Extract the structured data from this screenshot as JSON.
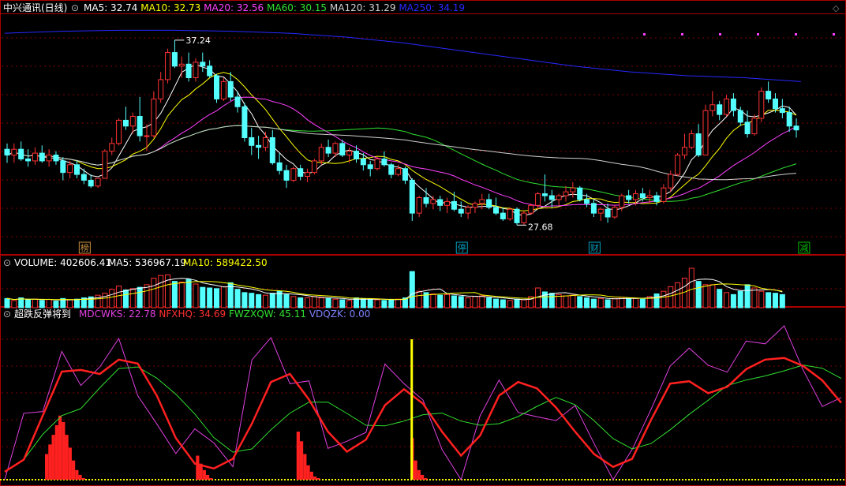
{
  "price_panel": {
    "title": "中兴通讯(日线)",
    "mas": [
      {
        "label": "MA5: 32.74",
        "color": "#ffffff"
      },
      {
        "label": "MA10: 32.73",
        "color": "#ffff00"
      },
      {
        "label": "MA20: 32.56",
        "color": "#ff40ff"
      },
      {
        "label": "MA60: 30.15",
        "color": "#30e030"
      },
      {
        "label": "MA120: 31.29",
        "color": "#d0d0d0"
      },
      {
        "label": "MA250: 34.19",
        "color": "#2828ff"
      }
    ],
    "high_marker": "37.24",
    "low_marker": "27.68",
    "events": [
      {
        "label": "榜",
        "color": "#c89040"
      },
      {
        "label": "停",
        "color": "#00a0c0"
      },
      {
        "label": "财",
        "color": "#00a0c0"
      },
      {
        "label": "减",
        "color": "#00c000"
      }
    ]
  },
  "volume_panel": {
    "title": "VOLUME: 402606.41",
    "ma5": "MA5: 536967.19",
    "ma10": "MA10: 589422.50"
  },
  "indicator_panel": {
    "title": "超跌反弹将到",
    "items": [
      {
        "label": "MDCWKS: 22.78",
        "color": "#e040e0"
      },
      {
        "label": "NFXHQ: 34.69",
        "color": "#ff3030"
      },
      {
        "label": "FWZXQW: 45.11",
        "color": "#30e030"
      },
      {
        "label": "VDQZK: 0.00",
        "color": "#8080ff"
      }
    ]
  },
  "colors": {
    "up": "#ff3232",
    "down": "#54ffff",
    "grid": "#800000",
    "axis": "#aa0000"
  },
  "chart_data": {
    "type": "candlestick",
    "y_range": [
      27.0,
      38.5
    ],
    "ohlc": [
      [
        31.6,
        31.9,
        30.9,
        31.3
      ],
      [
        31.3,
        31.9,
        30.9,
        31.6
      ],
      [
        31.6,
        32.0,
        31.0,
        31.1
      ],
      [
        31.1,
        31.6,
        30.7,
        31.0
      ],
      [
        31.0,
        31.7,
        30.8,
        31.4
      ],
      [
        31.4,
        31.8,
        30.9,
        31.0
      ],
      [
        31.0,
        31.6,
        30.7,
        31.3
      ],
      [
        31.3,
        31.5,
        30.8,
        31.0
      ],
      [
        31.0,
        31.2,
        30.0,
        30.4
      ],
      [
        30.4,
        31.0,
        30.1,
        30.8
      ],
      [
        30.8,
        31.0,
        30.1,
        30.3
      ],
      [
        30.3,
        30.6,
        29.8,
        30.0
      ],
      [
        30.0,
        30.3,
        29.6,
        29.7
      ],
      [
        29.7,
        30.1,
        29.6,
        30.1
      ],
      [
        30.1,
        31.6,
        30.1,
        31.5
      ],
      [
        31.5,
        32.2,
        31.3,
        31.9
      ],
      [
        31.9,
        33.2,
        31.8,
        33.1
      ],
      [
        33.1,
        33.8,
        32.6,
        32.8
      ],
      [
        32.8,
        33.5,
        32.4,
        33.3
      ],
      [
        33.3,
        34.3,
        32.0,
        32.3
      ],
      [
        32.3,
        32.9,
        31.5,
        32.3
      ],
      [
        32.3,
        34.6,
        32.2,
        34.2
      ],
      [
        34.2,
        35.6,
        34.0,
        35.2
      ],
      [
        35.2,
        36.8,
        35.0,
        36.6
      ],
      [
        36.6,
        37.24,
        35.8,
        35.9
      ],
      [
        35.9,
        36.4,
        35.3,
        36.0
      ],
      [
        36.0,
        36.6,
        35.1,
        35.3
      ],
      [
        35.3,
        36.3,
        35.1,
        36.1
      ],
      [
        36.1,
        36.6,
        35.6,
        35.9
      ],
      [
        35.9,
        36.2,
        35.3,
        35.4
      ],
      [
        35.4,
        35.5,
        34.0,
        34.2
      ],
      [
        34.2,
        35.3,
        34.1,
        35.1
      ],
      [
        35.1,
        35.6,
        34.1,
        34.3
      ],
      [
        34.3,
        34.6,
        33.5,
        33.8
      ],
      [
        33.8,
        34.0,
        32.0,
        32.2
      ],
      [
        32.2,
        32.7,
        31.3,
        31.8
      ],
      [
        31.8,
        32.3,
        31.1,
        31.7
      ],
      [
        31.7,
        32.5,
        31.5,
        32.2
      ],
      [
        32.2,
        32.6,
        30.8,
        30.9
      ],
      [
        30.9,
        31.4,
        30.3,
        30.5
      ],
      [
        30.5,
        30.8,
        29.6,
        30.0
      ],
      [
        30.0,
        30.7,
        29.9,
        30.6
      ],
      [
        30.6,
        30.8,
        30.0,
        30.2
      ],
      [
        30.2,
        30.6,
        29.9,
        30.4
      ],
      [
        30.4,
        31.1,
        30.3,
        31.0
      ],
      [
        31.0,
        31.9,
        30.8,
        31.7
      ],
      [
        31.7,
        32.1,
        31.2,
        31.4
      ],
      [
        31.4,
        32.0,
        31.2,
        31.9
      ],
      [
        31.9,
        32.1,
        31.2,
        31.3
      ],
      [
        31.3,
        31.7,
        30.9,
        31.5
      ],
      [
        31.5,
        31.8,
        30.9,
        31.1
      ],
      [
        31.1,
        31.4,
        30.5,
        30.8
      ],
      [
        30.8,
        31.0,
        30.2,
        30.6
      ],
      [
        30.6,
        31.2,
        30.5,
        31.1
      ],
      [
        31.1,
        31.5,
        30.7,
        30.8
      ],
      [
        30.8,
        30.9,
        30.1,
        30.3
      ],
      [
        30.3,
        30.8,
        30.2,
        30.6
      ],
      [
        30.6,
        30.7,
        29.8,
        30.0
      ],
      [
        30.0,
        30.1,
        27.9,
        28.3
      ],
      [
        28.3,
        29.2,
        28.1,
        29.1
      ],
      [
        29.1,
        29.6,
        28.6,
        28.8
      ],
      [
        28.8,
        29.2,
        28.5,
        29.0
      ],
      [
        29.0,
        29.2,
        28.4,
        28.7
      ],
      [
        28.7,
        29.1,
        28.3,
        28.9
      ],
      [
        28.9,
        29.4,
        28.4,
        28.5
      ],
      [
        28.5,
        28.9,
        28.1,
        28.3
      ],
      [
        28.3,
        28.7,
        28.0,
        28.6
      ],
      [
        28.6,
        28.9,
        28.3,
        28.8
      ],
      [
        28.8,
        29.3,
        28.5,
        29.0
      ],
      [
        29.0,
        29.3,
        28.5,
        28.6
      ],
      [
        28.6,
        29.1,
        28.2,
        28.3
      ],
      [
        28.3,
        28.6,
        27.9,
        28.0
      ],
      [
        28.0,
        28.6,
        27.9,
        28.5
      ],
      [
        28.5,
        28.6,
        27.68,
        27.8
      ],
      [
        27.8,
        28.4,
        27.7,
        28.3
      ],
      [
        28.3,
        28.8,
        28.2,
        28.7
      ],
      [
        28.7,
        29.4,
        28.5,
        29.3
      ],
      [
        29.3,
        30.3,
        28.9,
        29.2
      ],
      [
        29.2,
        29.5,
        28.6,
        29.0
      ],
      [
        29.0,
        29.3,
        28.7,
        29.2
      ],
      [
        29.2,
        29.7,
        28.9,
        29.4
      ],
      [
        29.4,
        29.9,
        29.1,
        29.6
      ],
      [
        29.6,
        29.7,
        28.9,
        29.0
      ],
      [
        29.0,
        29.3,
        28.6,
        28.8
      ],
      [
        28.8,
        29.0,
        28.1,
        28.3
      ],
      [
        28.3,
        28.6,
        27.9,
        28.5
      ],
      [
        28.5,
        28.8,
        27.8,
        28.1
      ],
      [
        28.1,
        28.7,
        28.0,
        28.6
      ],
      [
        28.6,
        29.3,
        28.4,
        29.2
      ],
      [
        29.2,
        29.5,
        28.8,
        29.0
      ],
      [
        29.0,
        29.5,
        28.7,
        29.3
      ],
      [
        29.3,
        29.6,
        28.9,
        29.1
      ],
      [
        29.1,
        29.5,
        28.8,
        29.2
      ],
      [
        29.2,
        29.4,
        28.7,
        28.9
      ],
      [
        28.9,
        29.8,
        28.8,
        29.6
      ],
      [
        29.6,
        30.5,
        29.4,
        30.3
      ],
      [
        30.3,
        31.4,
        30.2,
        31.3
      ],
      [
        31.3,
        32.4,
        31.1,
        31.7
      ],
      [
        31.7,
        32.6,
        31.6,
        32.4
      ],
      [
        32.4,
        32.9,
        31.2,
        31.3
      ],
      [
        31.3,
        33.9,
        31.3,
        33.6
      ],
      [
        33.6,
        34.6,
        33.3,
        33.9
      ],
      [
        33.9,
        34.1,
        33.1,
        33.4
      ],
      [
        33.4,
        34.4,
        33.3,
        34.2
      ],
      [
        34.2,
        34.5,
        33.3,
        33.6
      ],
      [
        33.6,
        33.8,
        32.8,
        33.0
      ],
      [
        33.0,
        33.6,
        32.2,
        32.4
      ],
      [
        32.4,
        33.4,
        32.3,
        33.2
      ],
      [
        33.2,
        34.8,
        33.0,
        34.6
      ],
      [
        34.6,
        35.1,
        34.0,
        34.2
      ],
      [
        34.2,
        34.5,
        33.5,
        33.7
      ],
      [
        33.7,
        34.2,
        33.2,
        33.5
      ],
      [
        33.5,
        33.8,
        32.5,
        32.8
      ],
      [
        32.8,
        33.2,
        32.2,
        32.6
      ]
    ],
    "gaps": [
      [
        33,
        34
      ],
      [
        44,
        45
      ],
      [
        58,
        59
      ],
      [
        99,
        100
      ]
    ],
    "series": [
      {
        "name": "MA5",
        "color": "#ffffff"
      },
      {
        "name": "MA10",
        "color": "#ffff00"
      },
      {
        "name": "MA20",
        "color": "#ff40ff"
      },
      {
        "name": "MA60",
        "color": "#30e030"
      },
      {
        "name": "MA120",
        "color": "#d0d0d0"
      },
      {
        "name": "MA250",
        "color": "#2828ff"
      }
    ],
    "ma250": [
      37.6,
      37.7,
      37.75,
      37.75,
      37.7,
      37.6,
      37.4,
      37.1,
      36.7,
      36.3,
      35.9,
      35.6,
      35.4,
      35.3,
      35.1
    ],
    "volume": [
      28,
      22,
      30,
      24,
      26,
      22,
      25,
      20,
      28,
      24,
      26,
      30,
      33,
      38,
      44,
      56,
      66,
      54,
      58,
      62,
      70,
      90,
      98,
      100,
      80,
      78,
      86,
      72,
      62,
      60,
      58,
      64,
      76,
      56,
      46,
      44,
      40,
      38,
      44,
      50,
      40,
      34,
      30,
      30,
      34,
      30,
      28,
      26,
      24,
      22,
      30,
      28,
      26,
      24,
      22,
      24,
      26,
      30,
      110,
      50,
      46,
      42,
      38,
      40,
      36,
      34,
      30,
      34,
      36,
      30,
      26,
      24,
      22,
      26,
      24,
      34,
      60,
      48,
      44,
      40,
      36,
      38,
      34,
      30,
      26,
      28,
      24,
      28,
      32,
      30,
      28,
      26,
      34,
      42,
      50,
      64,
      76,
      90,
      120,
      80,
      70,
      70,
      56,
      46,
      40,
      50,
      70,
      60,
      50,
      46,
      44,
      40
    ],
    "indicator": {
      "range": [
        0,
        100
      ],
      "red_bars": [
        [
          12,
          16
        ],
        [
          13,
          22
        ],
        [
          14,
          28
        ],
        [
          15,
          34
        ],
        [
          16,
          40
        ],
        [
          17,
          36
        ],
        [
          18,
          28
        ],
        [
          19,
          20
        ],
        [
          20,
          12
        ],
        [
          21,
          6
        ],
        [
          22,
          3
        ],
        [
          23,
          1
        ],
        [
          57,
          15
        ],
        [
          58,
          10
        ],
        [
          59,
          6
        ],
        [
          60,
          3
        ],
        [
          61,
          1
        ],
        [
          87,
          30
        ],
        [
          88,
          24
        ],
        [
          89,
          16
        ],
        [
          90,
          9
        ],
        [
          91,
          5
        ],
        [
          92,
          2
        ],
        [
          93,
          1
        ],
        [
          121,
          26
        ],
        [
          122,
          12
        ],
        [
          123,
          6
        ],
        [
          124,
          3
        ],
        [
          125,
          1
        ]
      ],
      "yellow_bar_index": 121
    }
  }
}
